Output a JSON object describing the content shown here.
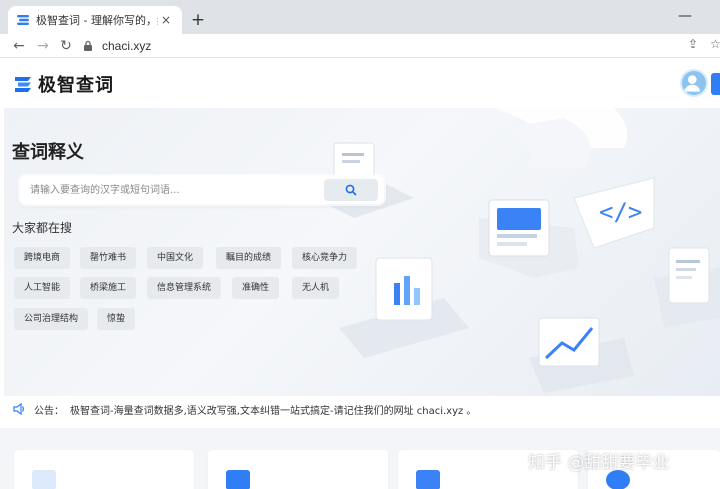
{
  "browser": {
    "tab_title": "极智查词 - 理解你写的，给你想要",
    "new_tab": "+",
    "tab_close": "×",
    "window_minimize": "—",
    "url": "chaci.xyz"
  },
  "site": {
    "logo_text": "极智查词"
  },
  "hero": {
    "title": "查词释义",
    "search_placeholder": "请输入要查询的汉字或短句词语...",
    "hot_title": "大家都在搜",
    "tags": [
      "跨境电商",
      "罄竹难书",
      "中国文化",
      "瞩目的成绩",
      "核心竞争力",
      "人工智能",
      "桥梁施工",
      "信息管理系统",
      "准确性",
      "无人机",
      "公司治理结构",
      "惊蛰"
    ]
  },
  "notice": {
    "label": "公告：",
    "text": "极智查词-海量查词数据多,语义改写强,文本纠错一站式搞定-请记住我们的网址 chaci.xyz 。"
  },
  "watermark": "知乎 @甜甜要毕业",
  "colors": {
    "accent": "#2f7ef5",
    "tag_bg": "#e6e9ed"
  }
}
